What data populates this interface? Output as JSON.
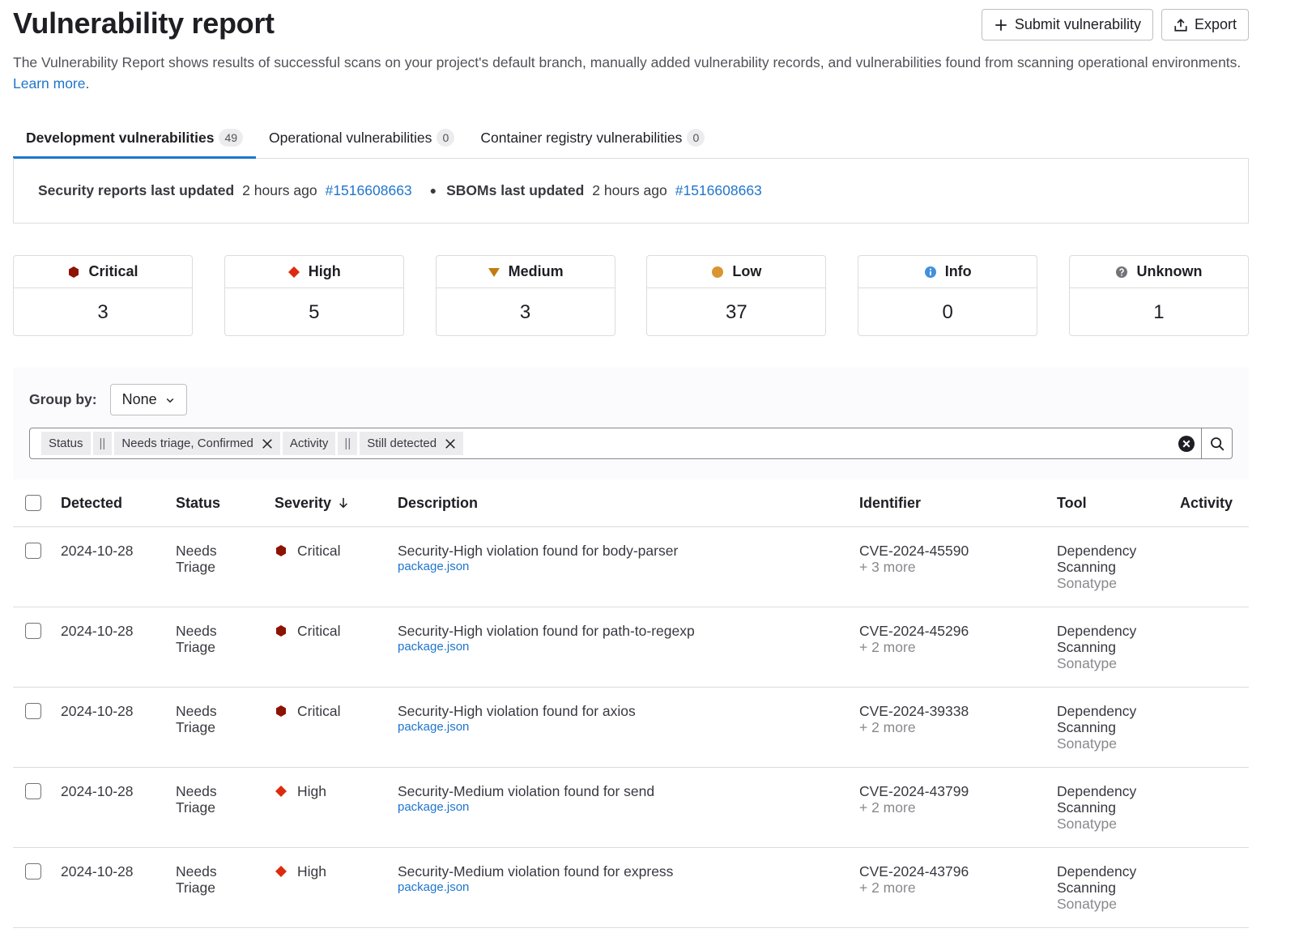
{
  "header": {
    "title": "Vulnerability report",
    "submit_label": "Submit vulnerability",
    "export_label": "Export",
    "description": "The Vulnerability Report shows results of successful scans on your project's default branch, manually added vulnerability records, and vulnerabilities found from scanning operational environments.",
    "learn_more": "Learn more",
    "learn_more_suffix": "."
  },
  "tabs": [
    {
      "label": "Development vulnerabilities",
      "count": "49",
      "active": true
    },
    {
      "label": "Operational vulnerabilities",
      "count": "0",
      "active": false
    },
    {
      "label": "Container registry vulnerabilities",
      "count": "0",
      "active": false
    }
  ],
  "updated": {
    "security_label": "Security reports last updated",
    "security_time": "2 hours ago",
    "security_pipeline": "#1516608663",
    "sbom_label": "SBOMs last updated",
    "sbom_time": "2 hours ago",
    "sbom_pipeline": "#1516608663"
  },
  "severity_cards": [
    {
      "label": "Critical",
      "count": "3",
      "color": "#8d1300",
      "icon": "critical-hexagon-icon"
    },
    {
      "label": "High",
      "count": "5",
      "color": "#dd2b0e",
      "icon": "high-diamond-icon"
    },
    {
      "label": "Medium",
      "count": "3",
      "color": "#c17d10",
      "icon": "medium-triangle-icon"
    },
    {
      "label": "Low",
      "count": "37",
      "color": "#d99530",
      "icon": "low-circle-icon"
    },
    {
      "label": "Info",
      "count": "0",
      "color": "#428fdc",
      "icon": "info-circle-icon"
    },
    {
      "label": "Unknown",
      "count": "1",
      "color": "#737278",
      "icon": "unknown-question-icon"
    }
  ],
  "filters": {
    "group_by_label": "Group by:",
    "group_by_value": "None",
    "tokens": {
      "status_key": "Status",
      "status_op": "||",
      "status_value": "Needs triage, Confirmed",
      "activity_key": "Activity",
      "activity_op": "||",
      "activity_value": "Still detected"
    }
  },
  "table": {
    "headers": {
      "detected": "Detected",
      "status": "Status",
      "severity": "Severity",
      "description": "Description",
      "identifier": "Identifier",
      "tool": "Tool",
      "activity": "Activity"
    },
    "rows": [
      {
        "date": "2024-10-28",
        "status_1": "Needs",
        "status_2": "Triage",
        "severity": "Critical",
        "severity_color": "#8d1300",
        "description": "Security-High violation found for body-parser",
        "file": "package.json",
        "identifier": "CVE-2024-45590",
        "more": "+ 3 more",
        "tool_1": "Dependency",
        "tool_2": "Scanning",
        "vendor": "Sonatype"
      },
      {
        "date": "2024-10-28",
        "status_1": "Needs",
        "status_2": "Triage",
        "severity": "Critical",
        "severity_color": "#8d1300",
        "description": "Security-High violation found for path-to-regexp",
        "file": "package.json",
        "identifier": "CVE-2024-45296",
        "more": "+ 2 more",
        "tool_1": "Dependency",
        "tool_2": "Scanning",
        "vendor": "Sonatype"
      },
      {
        "date": "2024-10-28",
        "status_1": "Needs",
        "status_2": "Triage",
        "severity": "Critical",
        "severity_color": "#8d1300",
        "description": "Security-High violation found for axios",
        "file": "package.json",
        "identifier": "CVE-2024-39338",
        "more": "+ 2 more",
        "tool_1": "Dependency",
        "tool_2": "Scanning",
        "vendor": "Sonatype"
      },
      {
        "date": "2024-10-28",
        "status_1": "Needs",
        "status_2": "Triage",
        "severity": "High",
        "severity_color": "#dd2b0e",
        "description": "Security-Medium violation found for send",
        "file": "package.json",
        "identifier": "CVE-2024-43799",
        "more": "+ 2 more",
        "tool_1": "Dependency",
        "tool_2": "Scanning",
        "vendor": "Sonatype"
      },
      {
        "date": "2024-10-28",
        "status_1": "Needs",
        "status_2": "Triage",
        "severity": "High",
        "severity_color": "#dd2b0e",
        "description": "Security-Medium violation found for express",
        "file": "package.json",
        "identifier": "CVE-2024-43796",
        "more": "+ 2 more",
        "tool_1": "Dependency",
        "tool_2": "Scanning",
        "vendor": "Sonatype"
      }
    ]
  }
}
